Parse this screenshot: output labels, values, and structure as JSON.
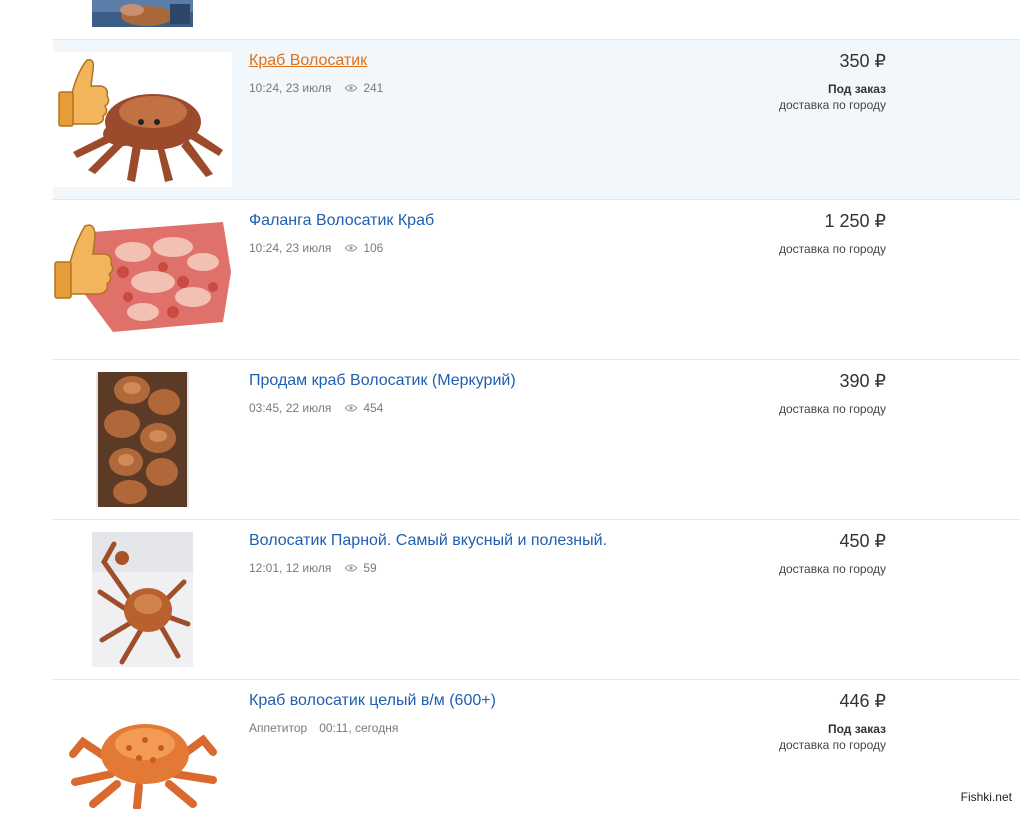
{
  "listings": [
    {
      "title": "Краб Волосатик",
      "date": "10:24, 23 июля",
      "views": "241",
      "price": "350 ₽",
      "order": "Под заказ",
      "delivery": "доставка по городу"
    },
    {
      "title": "Фаланга Волосатик Краб",
      "date": "10:24, 23 июля",
      "views": "106",
      "price": "1 250 ₽",
      "delivery": "доставка по городу"
    },
    {
      "title": "Продам краб Волосатик (Меркурий)",
      "date": "03:45, 22 июля",
      "views": "454",
      "price": "390 ₽",
      "delivery": "доставка по городу"
    },
    {
      "title": "Волосатик Парной. Самый вкусный и полезный.",
      "date": "12:01, 12 июля",
      "views": "59",
      "price": "450 ₽",
      "delivery": "доставка по городу"
    },
    {
      "title": "Краб волосатик целый в/м (600+)",
      "seller": "Аппетитор",
      "date": "00:11, сегодня",
      "price": "446 ₽",
      "order": "Под заказ",
      "delivery": "доставка по городу"
    }
  ],
  "watermark": "Fishki.net",
  "colors": {
    "link": "#1e5fb3",
    "link_hover": "#e07116",
    "row_highlight": "#f1f7fa"
  }
}
